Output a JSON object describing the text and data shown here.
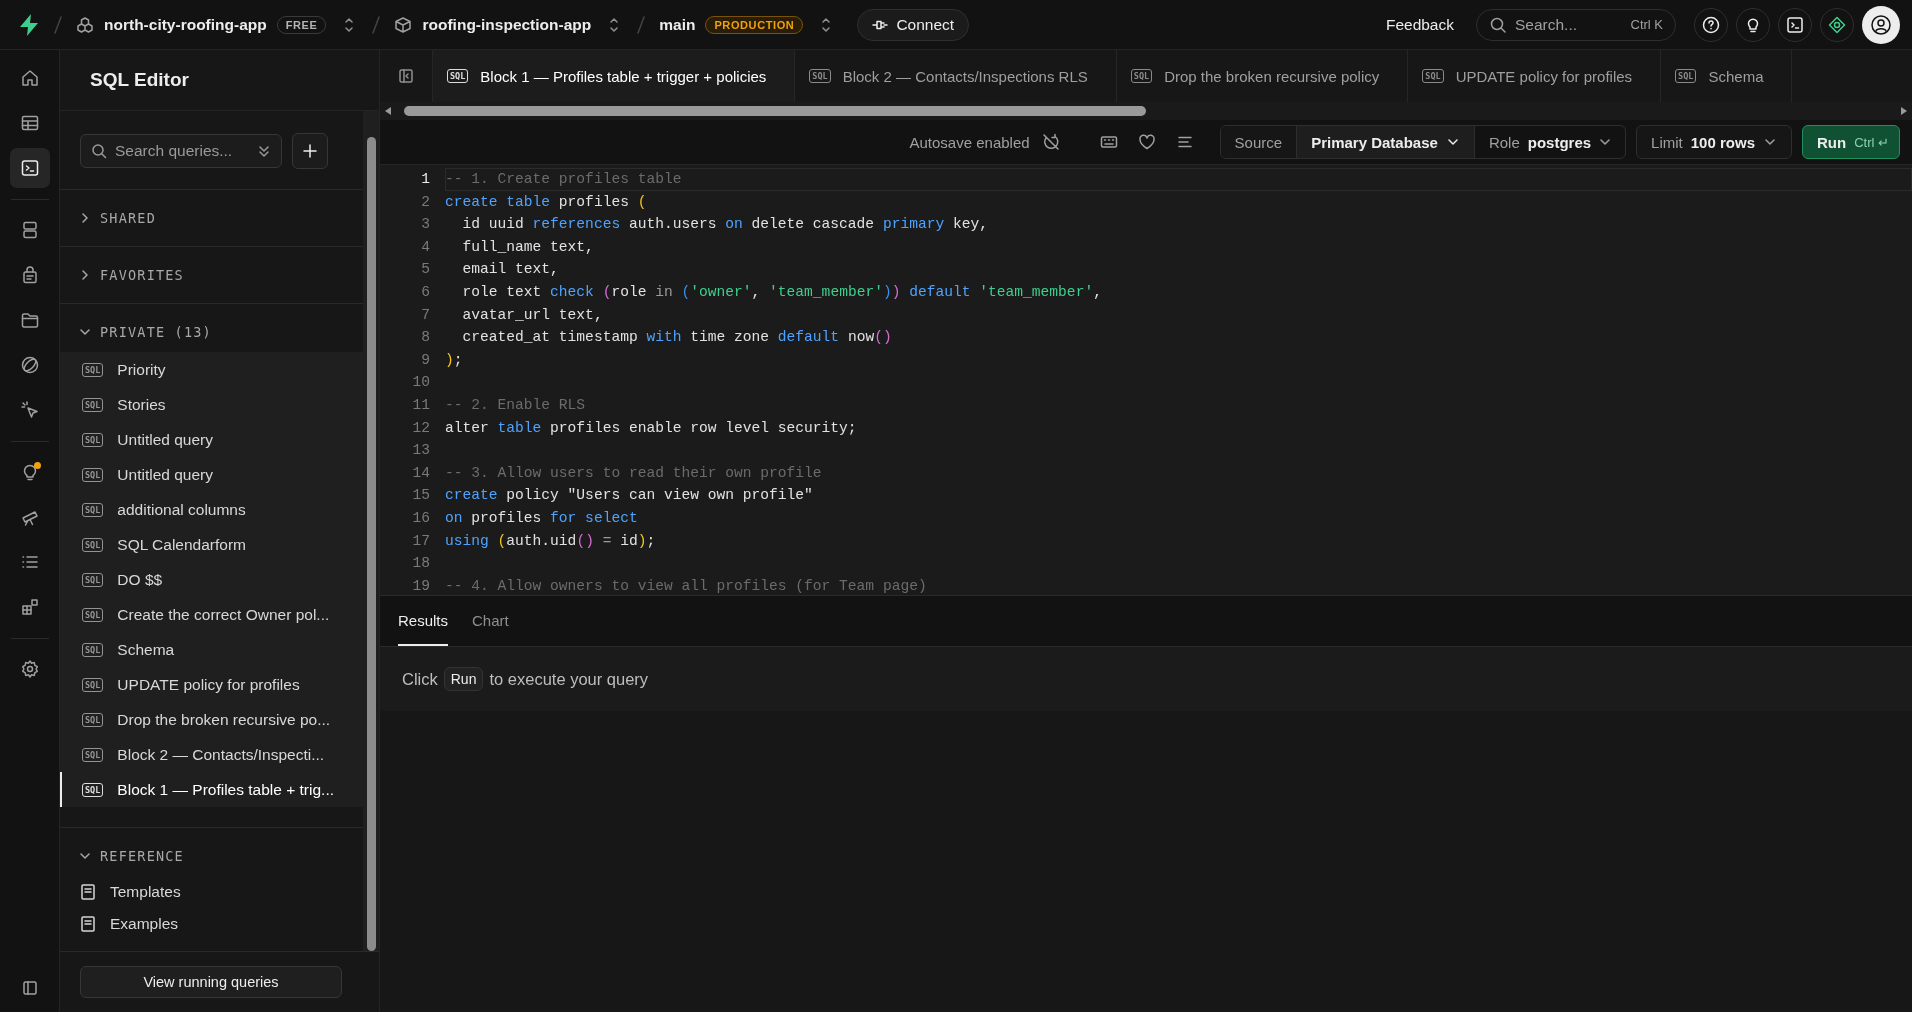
{
  "top_bar": {
    "org": {
      "name": "north-city-roofing-app",
      "plan": "FREE"
    },
    "project": {
      "name": "roofing-inspection-app"
    },
    "branch": {
      "name": "main",
      "badge": "PRODUCTION"
    },
    "connect": "Connect",
    "feedback": "Feedback",
    "search": {
      "placeholder": "Search...",
      "shortcut": "Ctrl K"
    }
  },
  "rail": [
    {
      "kind": "home",
      "selected": false
    },
    {
      "kind": "table",
      "selected": false
    },
    {
      "kind": "terminal",
      "selected": true
    },
    {
      "kind": "divider"
    },
    {
      "kind": "database",
      "selected": false
    },
    {
      "kind": "lock",
      "selected": false
    },
    {
      "kind": "folder",
      "selected": false
    },
    {
      "kind": "globe",
      "selected": false
    },
    {
      "kind": "cursor",
      "selected": false
    },
    {
      "kind": "divider"
    },
    {
      "kind": "bulb",
      "selected": false,
      "notification": true
    },
    {
      "kind": "telescope",
      "selected": false
    },
    {
      "kind": "list",
      "selected": false
    },
    {
      "kind": "blocks",
      "selected": false
    },
    {
      "kind": "divider"
    },
    {
      "kind": "gear",
      "selected": false
    }
  ],
  "sidebar": {
    "title": "SQL Editor",
    "search": {
      "placeholder": "Search queries..."
    },
    "sections": [
      {
        "label": "SHARED",
        "expanded": false
      },
      {
        "label": "FAVORITES",
        "expanded": false
      },
      {
        "label": "PRIVATE (13)",
        "expanded": true,
        "items": [
          {
            "badge": "SQL",
            "label": "Priority",
            "selected": false
          },
          {
            "badge": "SQL",
            "label": "Stories",
            "selected": false
          },
          {
            "badge": "SQL",
            "label": "Untitled query",
            "selected": false
          },
          {
            "badge": "SQL",
            "label": "Untitled query",
            "selected": false
          },
          {
            "badge": "SQL",
            "label": "additional columns",
            "selected": false
          },
          {
            "badge": "SQL",
            "label": "SQL Calendarform",
            "selected": false
          },
          {
            "badge": "SQL",
            "label": "DO $$",
            "selected": false
          },
          {
            "badge": "SQL",
            "label": "Create the correct Owner pol...",
            "selected": false
          },
          {
            "badge": "SQL",
            "label": "Schema",
            "selected": false
          },
          {
            "badge": "SQL",
            "label": "UPDATE policy for profiles",
            "selected": false
          },
          {
            "badge": "SQL",
            "label": "Drop the broken recursive po...",
            "selected": false
          },
          {
            "badge": "SQL",
            "label": "Block 2 — Contacts/Inspecti...",
            "selected": false
          },
          {
            "badge": "SQL",
            "label": "Block 1 — Profiles table + trig...",
            "selected": true
          }
        ]
      },
      {
        "label": "REFERENCE",
        "expanded": true,
        "links": [
          "Templates",
          "Examples"
        ]
      }
    ],
    "footer_button": "View running queries"
  },
  "tabs": [
    {
      "badge": "SQL",
      "label": "Block 1 — Profiles table + trigger + policies",
      "selected": true
    },
    {
      "badge": "SQL",
      "label": "Block 2 — Contacts/Inspections RLS",
      "selected": false
    },
    {
      "badge": "SQL",
      "label": "Drop the broken recursive policy",
      "selected": false
    },
    {
      "badge": "SQL",
      "label": "UPDATE policy for profiles",
      "selected": false
    },
    {
      "badge": "SQL",
      "label": "Schema",
      "selected": false
    }
  ],
  "toolbar": {
    "autosave": "Autosave enabled",
    "source": "Source",
    "database": "Primary Database",
    "role_label": "Role",
    "role": "postgres",
    "limit_label": "Limit",
    "limit": "100 rows",
    "run": "Run",
    "run_shortcut": "Ctrl ↵"
  },
  "code": [
    {
      "number": "1",
      "active": true,
      "tokens": [
        {
          "kind": "comment",
          "text": "-- 1. Create profiles table"
        }
      ]
    },
    {
      "number": "2",
      "active": false,
      "tokens": [
        {
          "kind": "keyword",
          "text": "create table"
        },
        {
          "kind": "plain",
          "text": " profiles "
        },
        {
          "kind": "paren1",
          "text": "("
        }
      ]
    },
    {
      "number": "3",
      "active": false,
      "tokens": [
        {
          "kind": "plain",
          "text": "  id uuid "
        },
        {
          "kind": "keyword",
          "text": "references"
        },
        {
          "kind": "plain",
          "text": " auth.users "
        },
        {
          "kind": "keyword",
          "text": "on"
        },
        {
          "kind": "plain",
          "text": " delete cascade "
        },
        {
          "kind": "keyword",
          "text": "primary"
        },
        {
          "kind": "plain",
          "text": " key,"
        }
      ]
    },
    {
      "number": "4",
      "active": false,
      "tokens": [
        {
          "kind": "plain",
          "text": "  full_name text,"
        }
      ]
    },
    {
      "number": "5",
      "active": false,
      "tokens": [
        {
          "kind": "plain",
          "text": "  email text,"
        }
      ]
    },
    {
      "number": "6",
      "active": false,
      "tokens": [
        {
          "kind": "plain",
          "text": "  role text "
        },
        {
          "kind": "keyword",
          "text": "check "
        },
        {
          "kind": "paren2",
          "text": "("
        },
        {
          "kind": "plain",
          "text": "role "
        },
        {
          "kind": "operator",
          "text": "in "
        },
        {
          "kind": "paren3",
          "text": "("
        },
        {
          "kind": "string",
          "text": "'owner'"
        },
        {
          "kind": "plain",
          "text": ", "
        },
        {
          "kind": "string",
          "text": "'team_member'"
        },
        {
          "kind": "paren3",
          "text": ")"
        },
        {
          "kind": "paren2",
          "text": ")"
        },
        {
          "kind": "keyword",
          "text": " default "
        },
        {
          "kind": "string",
          "text": "'team_member'"
        },
        {
          "kind": "plain",
          "text": ","
        }
      ]
    },
    {
      "number": "7",
      "active": false,
      "tokens": [
        {
          "kind": "plain",
          "text": "  avatar_url text,"
        }
      ]
    },
    {
      "number": "8",
      "active": false,
      "tokens": [
        {
          "kind": "plain",
          "text": "  created_at timestamp "
        },
        {
          "kind": "keyword",
          "text": "with"
        },
        {
          "kind": "plain",
          "text": " time zone "
        },
        {
          "kind": "keyword",
          "text": "default"
        },
        {
          "kind": "plain",
          "text": " now"
        },
        {
          "kind": "paren2",
          "text": "()"
        }
      ]
    },
    {
      "number": "9",
      "active": false,
      "tokens": [
        {
          "kind": "paren1",
          "text": ")"
        },
        {
          "kind": "plain",
          "text": ";"
        }
      ]
    },
    {
      "number": "10",
      "active": false
    },
    {
      "number": "11",
      "active": false,
      "tokens": [
        {
          "kind": "comment",
          "text": "-- 2. Enable RLS"
        }
      ]
    },
    {
      "number": "12",
      "active": false,
      "tokens": [
        {
          "kind": "plain",
          "text": "alter "
        },
        {
          "kind": "keyword",
          "text": "table"
        },
        {
          "kind": "plain",
          "text": " profiles enable row level security;"
        }
      ]
    },
    {
      "number": "13",
      "active": false
    },
    {
      "number": "14",
      "active": false,
      "tokens": [
        {
          "kind": "comment",
          "text": "-- 3. Allow users to read their own profile"
        }
      ]
    },
    {
      "number": "15",
      "active": false,
      "tokens": [
        {
          "kind": "keyword",
          "text": "create"
        },
        {
          "kind": "plain",
          "text": " policy \"Users can view own profile\""
        }
      ]
    },
    {
      "number": "16",
      "active": false,
      "tokens": [
        {
          "kind": "keyword",
          "text": "on"
        },
        {
          "kind": "plain",
          "text": " profiles "
        },
        {
          "kind": "keyword",
          "text": "for select"
        }
      ]
    },
    {
      "number": "17",
      "active": false,
      "tokens": [
        {
          "kind": "keyword",
          "text": "using "
        },
        {
          "kind": "paren1",
          "text": "("
        },
        {
          "kind": "plain",
          "text": "auth.uid"
        },
        {
          "kind": "paren2",
          "text": "()"
        },
        {
          "kind": "operator",
          "text": " = "
        },
        {
          "kind": "plain",
          "text": "id"
        },
        {
          "kind": "paren1",
          "text": ")"
        },
        {
          "kind": "plain",
          "text": ";"
        }
      ]
    },
    {
      "number": "18",
      "active": false
    },
    {
      "number": "19",
      "active": false,
      "tokens": [
        {
          "kind": "comment",
          "text": "-- 4. Allow owners to view all profiles (for Team page)"
        }
      ]
    }
  ],
  "results": {
    "tabs": [
      {
        "label": "Results",
        "selected": true
      },
      {
        "label": "Chart",
        "selected": false
      }
    ],
    "message": {
      "before": "Click",
      "key": "Run",
      "after": "to execute your query"
    }
  }
}
